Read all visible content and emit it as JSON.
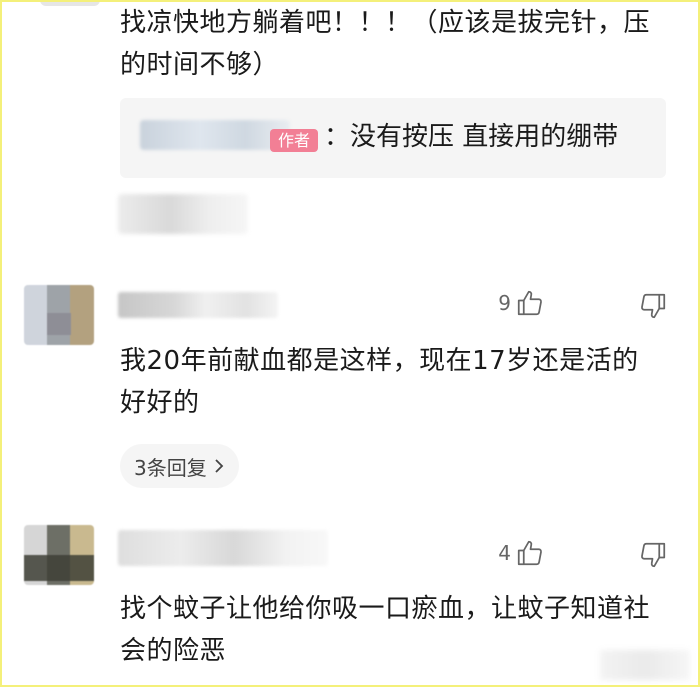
{
  "comments": [
    {
      "text": "找凉快地方躺着吧！！！（应该是拔完针，压的时间不够）",
      "reply": {
        "author_badge": "作者",
        "text": "：没有按压  直接用的绷带"
      }
    },
    {
      "likes": "9",
      "text": "我20年前献血都是这样，现在17岁还是活的好好的",
      "replies_label": "3条回复",
      "replies_chevron": "›"
    },
    {
      "likes": "4",
      "text": "找个蚊子让他给你吸一口瘀血，让蚊子知道社会的险恶"
    }
  ],
  "icons": {
    "like": "thumbs-up-icon",
    "dislike": "thumbs-down-icon",
    "chevron": "chevron-right-icon"
  },
  "colors": {
    "author_badge": "#f27f95",
    "icon": "#666666",
    "reply_bg": "#f5f5f5"
  }
}
